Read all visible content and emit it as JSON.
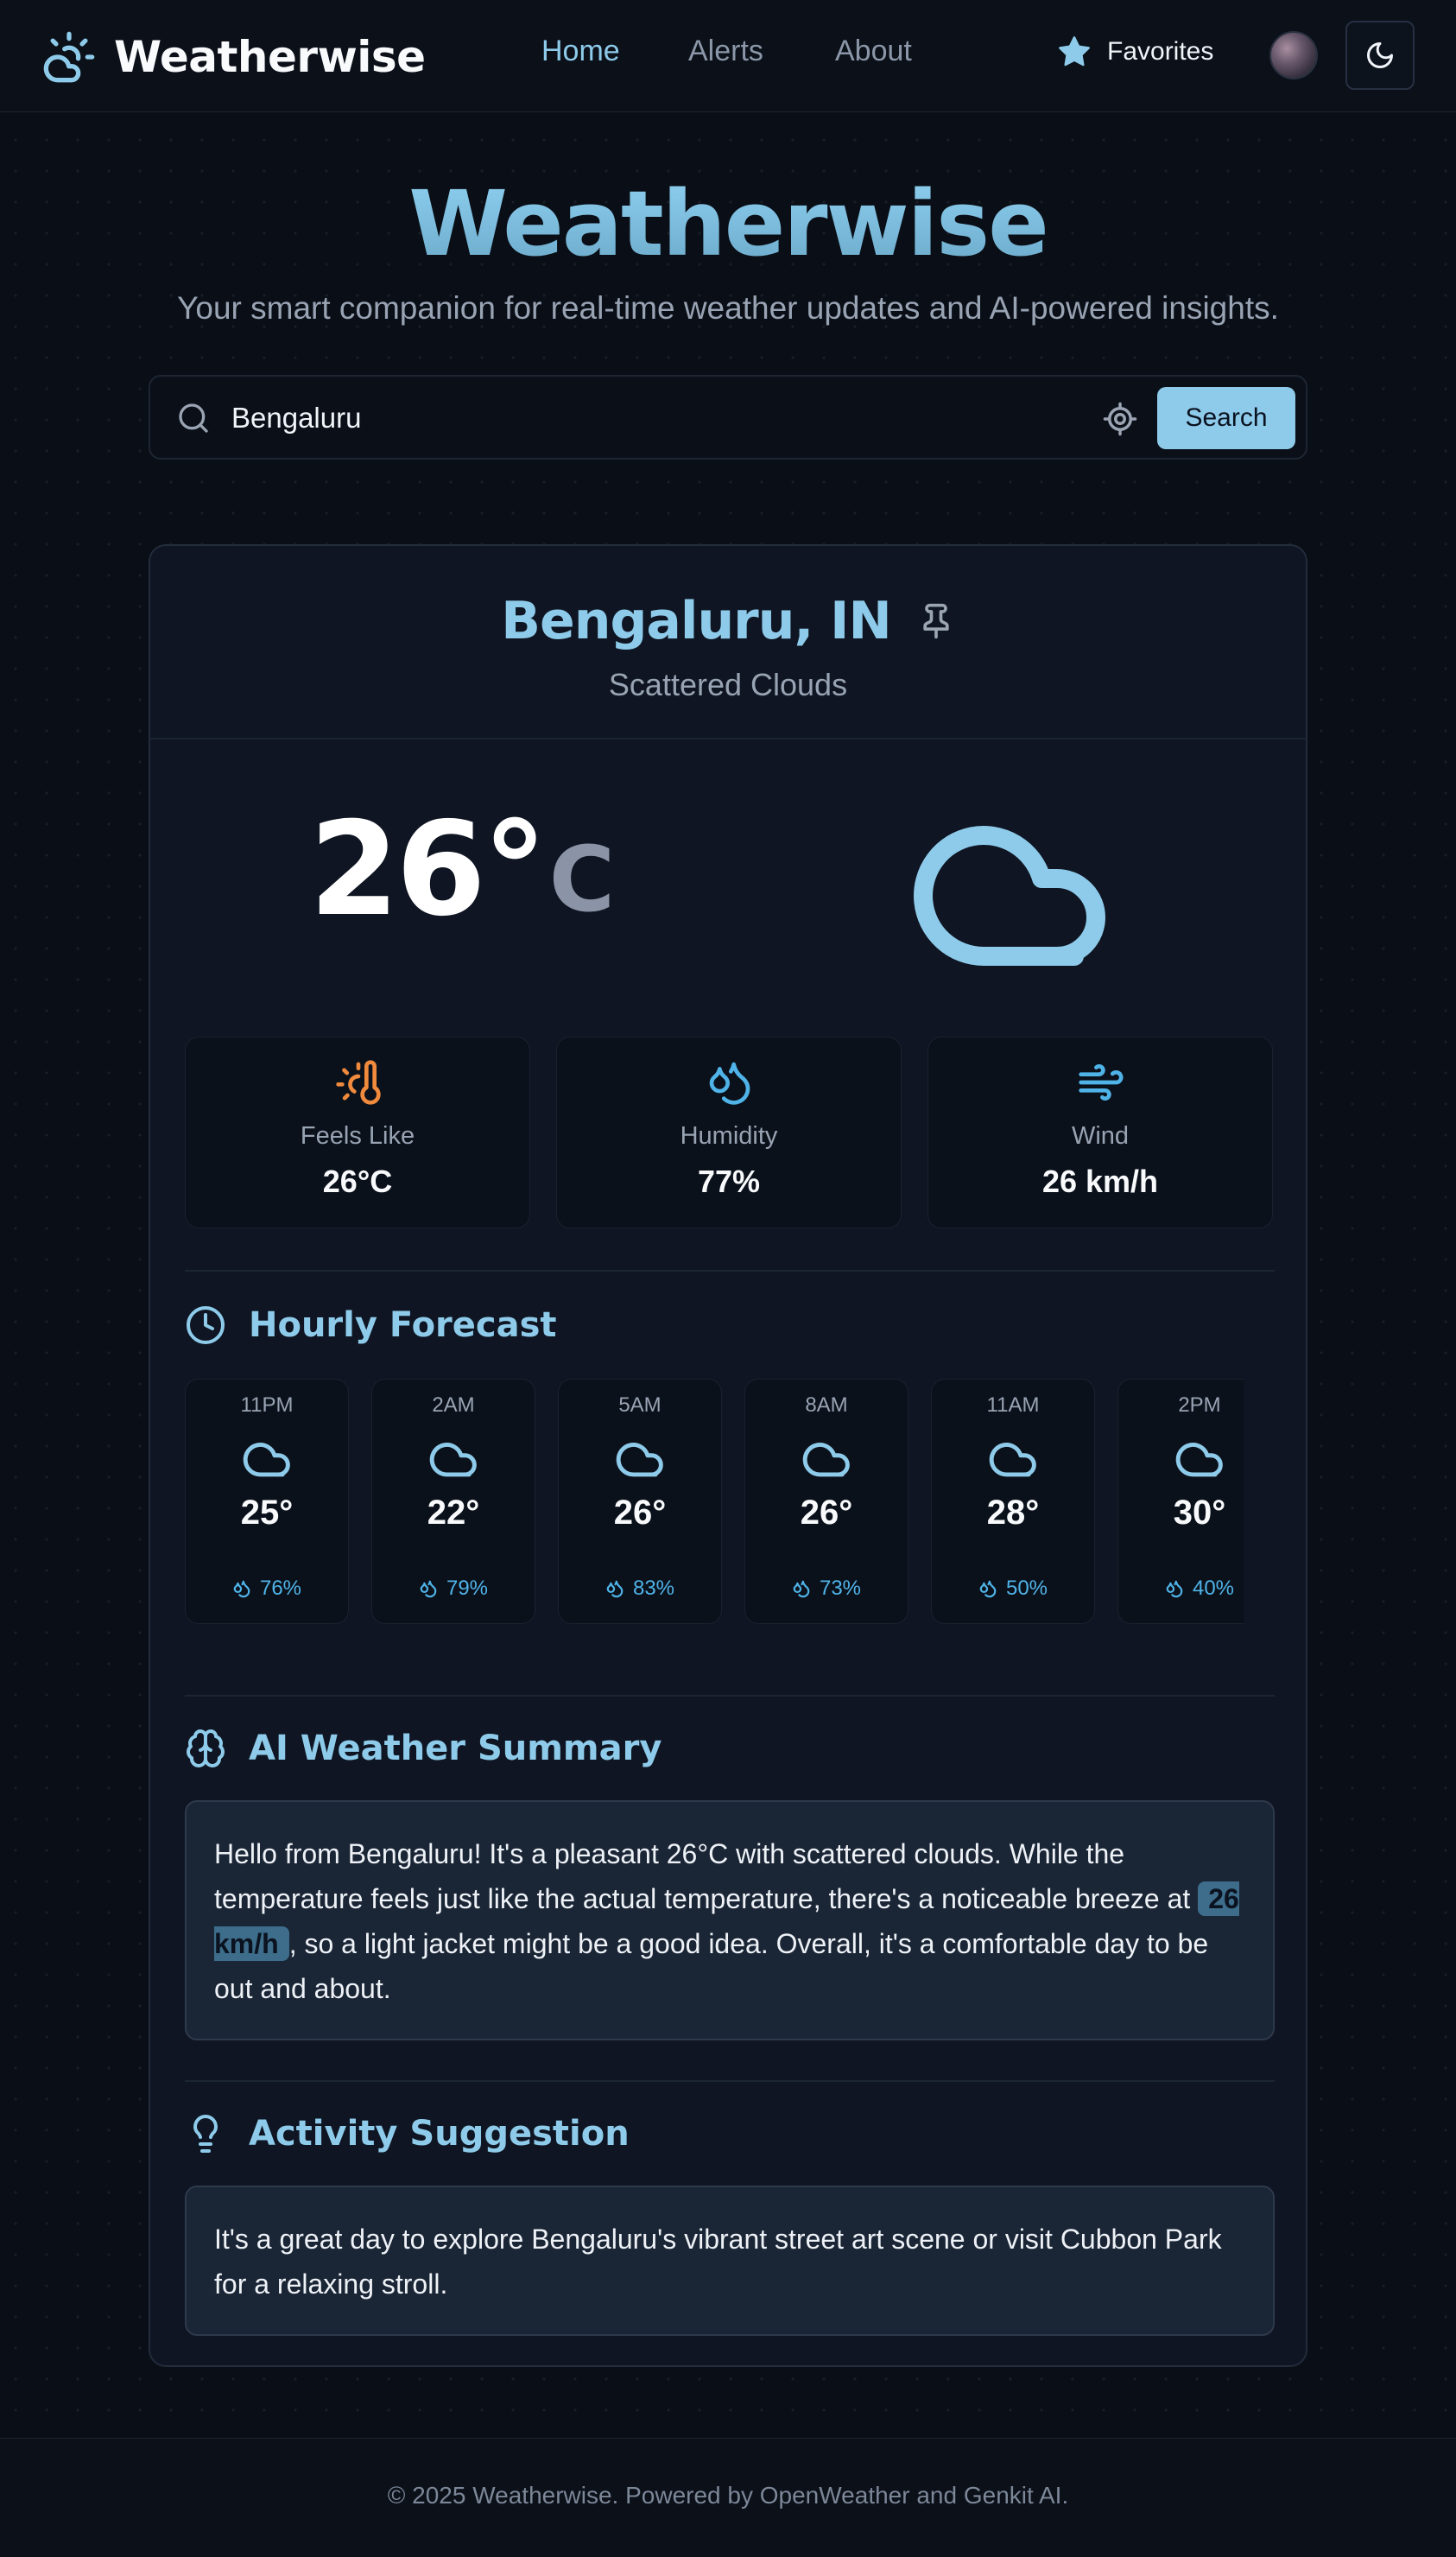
{
  "navbar": {
    "brand": "Weatherwise",
    "links": [
      "Home",
      "Alerts",
      "About"
    ],
    "active_link": "Home",
    "favorites_label": "Favorites",
    "icons": {
      "brand": "sun-cloud-icon",
      "favorites": "star-icon",
      "theme": "moon-icon"
    }
  },
  "hero": {
    "title": "Weatherwise",
    "subtitle": "Your smart companion for real-time weather updates and AI-powered insights."
  },
  "search": {
    "value": "Bengaluru",
    "button_label": "Search"
  },
  "weather": {
    "city": "Bengaluru, IN",
    "condition": "Scattered Clouds",
    "temperature": "26°",
    "unit": "C",
    "stats": [
      {
        "label": "Feels Like",
        "value": "26°C",
        "icon": "thermometer-sun-icon"
      },
      {
        "label": "Humidity",
        "value": "77%",
        "icon": "droplets-icon"
      },
      {
        "label": "Wind",
        "value": "26 km/h",
        "icon": "wind-icon"
      }
    ]
  },
  "hourly": {
    "title": "Hourly Forecast",
    "items": [
      {
        "time": "11PM",
        "temp": "25°",
        "humidity": "76%"
      },
      {
        "time": "2AM",
        "temp": "22°",
        "humidity": "79%"
      },
      {
        "time": "5AM",
        "temp": "26°",
        "humidity": "83%"
      },
      {
        "time": "8AM",
        "temp": "26°",
        "humidity": "73%"
      },
      {
        "time": "11AM",
        "temp": "28°",
        "humidity": "50%"
      },
      {
        "time": "2PM",
        "temp": "30°",
        "humidity": "40%"
      }
    ]
  },
  "ai_summary": {
    "title": "AI Weather Summary",
    "text_before": "Hello from Bengaluru! It's a pleasant 26°C with scattered clouds. While the temperature feels just like the actual temperature, there's a noticeable breeze at ",
    "highlight": "26 km/h",
    "text_after": ", so a light jacket might be a good idea. Overall, it's a comfortable day to be out and about."
  },
  "activity": {
    "title": "Activity Suggestion",
    "text": "It's a great day to explore Bengaluru's vibrant street art scene or visit Cubbon Park for a relaxing stroll."
  },
  "footer": {
    "text": "© 2025 Weatherwise. Powered by OpenWeather and Genkit AI."
  },
  "colors": {
    "accent": "#8ecbea",
    "background": "#0a0e16",
    "card": "#0f1522",
    "feels_like_icon": "#f08a3c",
    "humidity_icon": "#4fb3e8"
  }
}
